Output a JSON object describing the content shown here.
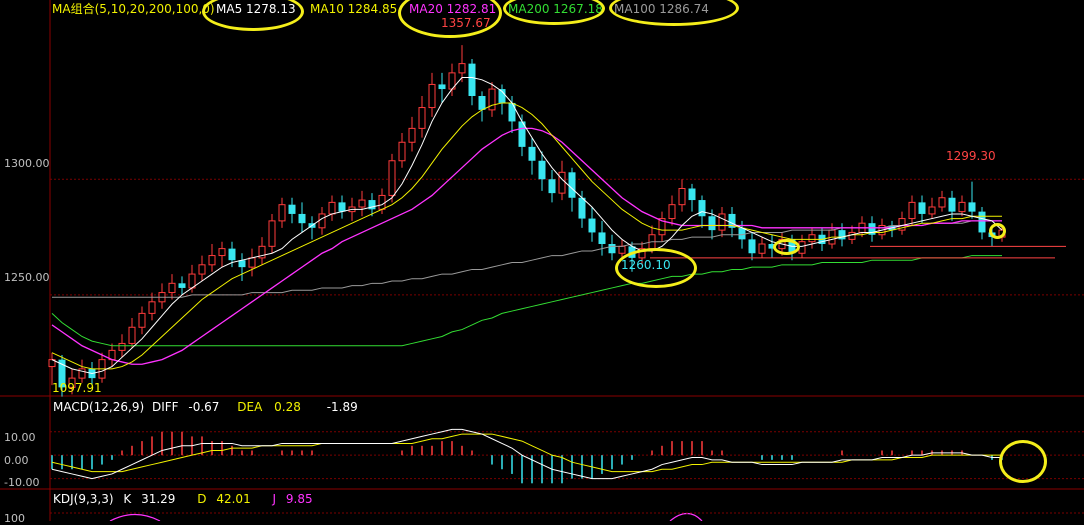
{
  "legend": {
    "ma_group": "MA组合(5,10,20,200,100,0)",
    "ma5": "MA5 1278.13",
    "ma10": "MA10 1284.85",
    "ma20": "MA20 1282.81",
    "ma200": "MA200 1267.18",
    "ma100": "MA100 1286.74"
  },
  "price_labels": {
    "high": "1357.67",
    "low": "1260.10",
    "recent_high": "1299.30",
    "start_low": "1097.91"
  },
  "macd": {
    "title": "MACD(12,26,9)",
    "diff_label": "DIFF",
    "diff_value": "-0.67",
    "dea_label": "DEA",
    "dea_value": "0.28",
    "macd_value": "-1.89"
  },
  "kdj": {
    "title": "KDJ(9,3,3)",
    "k_label": "K",
    "k_value": "31.29",
    "d_label": "D",
    "d_value": "42.01",
    "j_label": "J",
    "j_value": "9.85"
  },
  "colors": {
    "up": "#ff3b3b",
    "down": "#39e6f0",
    "ma5": "#ffffff",
    "ma10": "#f2f200",
    "ma20": "#ff33ff",
    "ma100": "#9a9a9a",
    "ma200": "#33dd33",
    "annotation": "#f4ee1a",
    "grid": "#7a0000"
  },
  "chart_data": [
    {
      "type": "candlestick",
      "title": "",
      "y_ticks": [
        "1300.00",
        "1250.00"
      ],
      "ylim": [
        1208,
        1368
      ],
      "annotations": [
        "1357.67",
        "1260.10",
        "1299.30"
      ],
      "candles": [
        [
          1219,
          1222,
          1211,
          1225
        ],
        [
          1222,
          1210,
          1206,
          1224
        ],
        [
          1210,
          1214,
          1207,
          1218
        ],
        [
          1214,
          1218,
          1212,
          1222
        ],
        [
          1218,
          1214,
          1211,
          1221
        ],
        [
          1214,
          1222,
          1212,
          1225
        ],
        [
          1222,
          1226,
          1219,
          1229
        ],
        [
          1226,
          1229,
          1223,
          1233
        ],
        [
          1229,
          1236,
          1227,
          1240
        ],
        [
          1236,
          1242,
          1233,
          1245
        ],
        [
          1242,
          1247,
          1239,
          1251
        ],
        [
          1247,
          1251,
          1244,
          1255
        ],
        [
          1251,
          1255,
          1248,
          1259
        ],
        [
          1255,
          1253,
          1250,
          1258
        ],
        [
          1253,
          1259,
          1251,
          1263
        ],
        [
          1259,
          1263,
          1256,
          1267
        ],
        [
          1263,
          1267,
          1260,
          1272
        ],
        [
          1267,
          1270,
          1262,
          1273
        ],
        [
          1270,
          1265,
          1262,
          1273
        ],
        [
          1265,
          1262,
          1256,
          1268
        ],
        [
          1262,
          1266,
          1258,
          1270
        ],
        [
          1266,
          1271,
          1263,
          1275
        ],
        [
          1271,
          1282,
          1268,
          1285
        ],
        [
          1282,
          1289,
          1279,
          1292
        ],
        [
          1289,
          1285,
          1281,
          1292
        ],
        [
          1285,
          1281,
          1277,
          1290
        ],
        [
          1281,
          1279,
          1274,
          1284
        ],
        [
          1279,
          1285,
          1276,
          1288
        ],
        [
          1285,
          1290,
          1282,
          1293
        ],
        [
          1290,
          1286,
          1283,
          1293
        ],
        [
          1286,
          1288,
          1282,
          1292
        ],
        [
          1288,
          1291,
          1284,
          1295
        ],
        [
          1291,
          1287,
          1284,
          1294
        ],
        [
          1287,
          1293,
          1285,
          1296
        ],
        [
          1293,
          1308,
          1290,
          1311
        ],
        [
          1308,
          1316,
          1305,
          1320
        ],
        [
          1316,
          1322,
          1312,
          1327
        ],
        [
          1322,
          1331,
          1318,
          1336
        ],
        [
          1331,
          1341,
          1327,
          1346
        ],
        [
          1341,
          1339,
          1333,
          1346
        ],
        [
          1339,
          1346,
          1336,
          1350
        ],
        [
          1346,
          1350,
          1342,
          1358
        ],
        [
          1350,
          1336,
          1332,
          1352
        ],
        [
          1336,
          1330,
          1325,
          1338
        ],
        [
          1330,
          1339,
          1327,
          1342
        ],
        [
          1339,
          1333,
          1328,
          1341
        ],
        [
          1333,
          1325,
          1320,
          1336
        ],
        [
          1325,
          1314,
          1310,
          1328
        ],
        [
          1314,
          1308,
          1302,
          1318
        ],
        [
          1308,
          1300,
          1295,
          1312
        ],
        [
          1300,
          1294,
          1290,
          1304
        ],
        [
          1294,
          1303,
          1291,
          1308
        ],
        [
          1303,
          1292,
          1286,
          1305
        ],
        [
          1292,
          1283,
          1279,
          1295
        ],
        [
          1283,
          1277,
          1273,
          1288
        ],
        [
          1277,
          1272,
          1267,
          1282
        ],
        [
          1272,
          1268,
          1265,
          1276
        ],
        [
          1268,
          1271,
          1266,
          1274
        ],
        [
          1271,
          1266,
          1260,
          1273
        ],
        [
          1266,
          1270,
          1263,
          1273
        ],
        [
          1270,
          1276,
          1268,
          1280
        ],
        [
          1276,
          1283,
          1273,
          1286
        ],
        [
          1283,
          1289,
          1280,
          1293
        ],
        [
          1289,
          1296,
          1286,
          1300
        ],
        [
          1296,
          1291,
          1286,
          1298
        ],
        [
          1291,
          1284,
          1279,
          1293
        ],
        [
          1284,
          1278,
          1274,
          1287
        ],
        [
          1278,
          1285,
          1275,
          1288
        ],
        [
          1285,
          1279,
          1275,
          1288
        ],
        [
          1279,
          1274,
          1270,
          1282
        ],
        [
          1274,
          1268,
          1265,
          1277
        ],
        [
          1268,
          1272,
          1266,
          1275
        ],
        [
          1272,
          1270,
          1266,
          1276
        ],
        [
          1270,
          1274,
          1267,
          1277
        ],
        [
          1274,
          1268,
          1265,
          1276
        ],
        [
          1268,
          1273,
          1266,
          1276
        ],
        [
          1273,
          1276,
          1270,
          1279
        ],
        [
          1276,
          1272,
          1269,
          1279
        ],
        [
          1272,
          1278,
          1270,
          1281
        ],
        [
          1278,
          1274,
          1271,
          1281
        ],
        [
          1274,
          1277,
          1272,
          1280
        ],
        [
          1277,
          1281,
          1275,
          1284
        ],
        [
          1281,
          1276,
          1273,
          1284
        ],
        [
          1276,
          1280,
          1274,
          1283
        ],
        [
          1280,
          1278,
          1275,
          1282
        ],
        [
          1278,
          1283,
          1276,
          1286
        ],
        [
          1283,
          1290,
          1280,
          1293
        ],
        [
          1290,
          1285,
          1281,
          1293
        ],
        [
          1285,
          1288,
          1283,
          1292
        ],
        [
          1288,
          1292,
          1286,
          1295
        ],
        [
          1292,
          1286,
          1282,
          1295
        ],
        [
          1286,
          1290,
          1284,
          1293
        ],
        [
          1290,
          1286,
          1283,
          1299
        ],
        [
          1286,
          1277,
          1274,
          1288
        ],
        [
          1277,
          1275,
          1271,
          1280
        ],
        [
          1275,
          1278,
          1273,
          1280
        ]
      ],
      "ma5": [
        1222,
        1220,
        1218,
        1217,
        1216,
        1217,
        1219,
        1223,
        1227,
        1231,
        1236,
        1241,
        1246,
        1250,
        1253,
        1256,
        1259,
        1262,
        1264,
        1265,
        1266,
        1267,
        1268,
        1270,
        1274,
        1277,
        1280,
        1283,
        1285,
        1286,
        1287,
        1287,
        1288,
        1289,
        1292,
        1298,
        1306,
        1315,
        1325,
        1333,
        1339,
        1344,
        1344,
        1343,
        1341,
        1338,
        1333,
        1325,
        1318,
        1311,
        1305,
        1300,
        1296,
        1292,
        1288,
        1283,
        1278,
        1274,
        1271,
        1269,
        1269,
        1271,
        1275,
        1280,
        1284,
        1286,
        1285,
        1283,
        1281,
        1279,
        1277,
        1275,
        1273,
        1272,
        1271,
        1271,
        1272,
        1273,
        1274,
        1275,
        1276,
        1277,
        1277,
        1278,
        1279,
        1280,
        1281,
        1282,
        1283,
        1284,
        1285,
        1285,
        1284,
        1283,
        1282,
        1278
      ],
      "ma10": [
        1225,
        1223,
        1221,
        1219,
        1218,
        1218,
        1218,
        1219,
        1221,
        1224,
        1228,
        1232,
        1236,
        1240,
        1244,
        1248,
        1251,
        1254,
        1257,
        1259,
        1261,
        1263,
        1265,
        1267,
        1269,
        1271,
        1273,
        1275,
        1277,
        1279,
        1281,
        1283,
        1285,
        1287,
        1289,
        1292,
        1296,
        1301,
        1307,
        1313,
        1318,
        1323,
        1327,
        1330,
        1332,
        1333,
        1333,
        1331,
        1328,
        1324,
        1319,
        1314,
        1309,
        1304,
        1299,
        1295,
        1291,
        1287,
        1284,
        1281,
        1279,
        1278,
        1278,
        1278,
        1279,
        1280,
        1280,
        1280,
        1280,
        1279,
        1278,
        1277,
        1276,
        1275,
        1274,
        1274,
        1274,
        1274,
        1275,
        1275,
        1276,
        1276,
        1277,
        1277,
        1278,
        1279,
        1280,
        1281,
        1281,
        1282,
        1283,
        1283,
        1284,
        1284,
        1284,
        1284
      ],
      "ma20": [
        1237,
        1234,
        1231,
        1228,
        1226,
        1224,
        1222,
        1221,
        1220,
        1220,
        1221,
        1222,
        1224,
        1226,
        1229,
        1232,
        1235,
        1238,
        1241,
        1244,
        1247,
        1250,
        1253,
        1256,
        1259,
        1262,
        1265,
        1268,
        1270,
        1273,
        1275,
        1277,
        1279,
        1281,
        1283,
        1285,
        1287,
        1290,
        1293,
        1297,
        1301,
        1305,
        1309,
        1313,
        1316,
        1319,
        1321,
        1322,
        1322,
        1321,
        1319,
        1316,
        1312,
        1308,
        1304,
        1300,
        1296,
        1292,
        1289,
        1286,
        1284,
        1282,
        1281,
        1280,
        1280,
        1280,
        1280,
        1280,
        1280,
        1280,
        1280,
        1279,
        1279,
        1279,
        1279,
        1279,
        1279,
        1279,
        1279,
        1279,
        1279,
        1279,
        1279,
        1279,
        1279,
        1280,
        1280,
        1280,
        1281,
        1281,
        1281,
        1282,
        1282,
        1282,
        1282,
        1282
      ],
      "ma100": [
        1249,
        1249,
        1249,
        1249,
        1249,
        1249,
        1249,
        1249,
        1249,
        1249,
        1249,
        1249,
        1249,
        1249,
        1250,
        1250,
        1250,
        1250,
        1250,
        1250,
        1251,
        1251,
        1251,
        1251,
        1252,
        1252,
        1252,
        1253,
        1253,
        1253,
        1254,
        1254,
        1255,
        1255,
        1256,
        1256,
        1257,
        1257,
        1258,
        1259,
        1259,
        1260,
        1261,
        1261,
        1262,
        1263,
        1264,
        1264,
        1265,
        1266,
        1267,
        1267,
        1268,
        1269,
        1269,
        1270,
        1271,
        1271,
        1272,
        1272,
        1273,
        1273,
        1274,
        1274,
        1275,
        1275,
        1275,
        1276,
        1276,
        1276,
        1277,
        1277,
        1277,
        1277,
        1278,
        1278,
        1278,
        1278,
        1278,
        1279,
        1279,
        1279,
        1279,
        1279,
        1280,
        1280,
        1280,
        1280,
        1281,
        1281,
        1281,
        1281,
        1282,
        1282,
        1282,
        1282
      ],
      "ma200": [
        1242,
        1238,
        1235,
        1232,
        1230,
        1229,
        1228,
        1228,
        1228,
        1228,
        1228,
        1228,
        1228,
        1228,
        1228,
        1228,
        1228,
        1228,
        1228,
        1228,
        1228,
        1228,
        1228,
        1228,
        1228,
        1228,
        1228,
        1228,
        1228,
        1228,
        1228,
        1228,
        1228,
        1228,
        1228,
        1228,
        1229,
        1230,
        1231,
        1232,
        1234,
        1235,
        1237,
        1239,
        1240,
        1242,
        1243,
        1244,
        1245,
        1246,
        1247,
        1248,
        1249,
        1250,
        1251,
        1252,
        1253,
        1254,
        1255,
        1255,
        1256,
        1257,
        1258,
        1258,
        1259,
        1259,
        1260,
        1260,
        1261,
        1261,
        1262,
        1262,
        1262,
        1263,
        1263,
        1263,
        1263,
        1264,
        1264,
        1264,
        1264,
        1264,
        1265,
        1265,
        1265,
        1265,
        1265,
        1266,
        1266,
        1266,
        1266,
        1266,
        1267,
        1267,
        1267,
        1267
      ]
    },
    {
      "type": "macd",
      "y_ticks": [
        "10.00",
        "0.00",
        "-10.00"
      ],
      "ylim": [
        -14,
        15
      ],
      "diff": [
        -6,
        -7,
        -8,
        -9,
        -10,
        -9,
        -8,
        -6,
        -4,
        -2,
        0,
        2,
        3,
        4,
        4,
        5,
        5,
        5,
        5,
        4,
        4,
        4,
        4,
        5,
        5,
        5,
        5,
        5,
        5,
        5,
        5,
        5,
        5,
        5,
        5,
        6,
        7,
        8,
        9,
        10,
        11,
        11,
        10,
        9,
        7,
        5,
        3,
        0,
        -2,
        -4,
        -6,
        -7,
        -8,
        -9,
        -10,
        -10,
        -10,
        -9,
        -8,
        -7,
        -6,
        -4,
        -3,
        -2,
        -1,
        -1,
        -2,
        -2,
        -3,
        -3,
        -3,
        -4,
        -4,
        -4,
        -4,
        -3,
        -3,
        -3,
        -3,
        -2,
        -2,
        -2,
        -2,
        -1,
        -1,
        -1,
        0,
        0,
        1,
        1,
        1,
        1,
        0,
        0,
        -1,
        -1
      ],
      "dea": [
        -3,
        -4,
        -5,
        -6,
        -7,
        -7,
        -7,
        -7,
        -6,
        -5,
        -4,
        -3,
        -2,
        -1,
        0,
        1,
        2,
        2,
        3,
        3,
        3,
        4,
        4,
        4,
        4,
        4,
        4,
        5,
        5,
        5,
        5,
        5,
        5,
        5,
        5,
        5,
        5,
        6,
        7,
        7,
        8,
        9,
        9,
        9,
        9,
        8,
        7,
        6,
        4,
        2,
        0,
        -1,
        -3,
        -4,
        -5,
        -6,
        -7,
        -7,
        -7,
        -7,
        -7,
        -6,
        -6,
        -5,
        -4,
        -4,
        -3,
        -3,
        -3,
        -3,
        -3,
        -3,
        -3,
        -3,
        -3,
        -3,
        -3,
        -3,
        -3,
        -3,
        -2,
        -2,
        -2,
        -2,
        -2,
        -1,
        -1,
        -1,
        0,
        0,
        0,
        0,
        0,
        0,
        0,
        0
      ],
      "hist": [
        -6,
        -6,
        -6,
        -6,
        -6,
        -4,
        -2,
        2,
        4,
        6,
        8,
        10,
        10,
        10,
        8,
        8,
        6,
        6,
        4,
        2,
        2,
        0,
        0,
        2,
        2,
        2,
        2,
        0,
        0,
        0,
        0,
        0,
        0,
        0,
        0,
        2,
        4,
        4,
        4,
        6,
        6,
        4,
        2,
        0,
        -4,
        -6,
        -8,
        -12,
        -12,
        -12,
        -12,
        -12,
        -10,
        -10,
        -10,
        -8,
        -6,
        -4,
        -2,
        0,
        2,
        4,
        6,
        6,
        6,
        6,
        2,
        2,
        0,
        0,
        0,
        -2,
        -2,
        -2,
        -2,
        0,
        0,
        0,
        0,
        2,
        0,
        0,
        0,
        2,
        2,
        0,
        2,
        2,
        2,
        2,
        2,
        2,
        0,
        0,
        -2,
        -2
      ]
    },
    {
      "type": "kdj",
      "y_ticks": [
        "100"
      ],
      "ylim": [
        0,
        110
      ]
    }
  ]
}
